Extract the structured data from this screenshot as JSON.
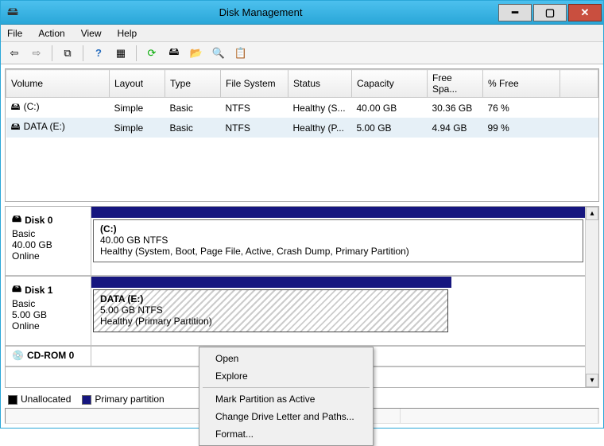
{
  "window": {
    "title": "Disk Management"
  },
  "menu": {
    "file": "File",
    "action": "Action",
    "view": "View",
    "help": "Help"
  },
  "columns": {
    "volume": "Volume",
    "layout": "Layout",
    "type": "Type",
    "fs": "File System",
    "status": "Status",
    "capacity": "Capacity",
    "free": "Free Spa...",
    "pct": "% Free"
  },
  "volumes": [
    {
      "name": "(C:)",
      "layout": "Simple",
      "type": "Basic",
      "fs": "NTFS",
      "status": "Healthy (S...",
      "capacity": "40.00 GB",
      "free": "30.36 GB",
      "pct": "76 %"
    },
    {
      "name": "DATA (E:)",
      "layout": "Simple",
      "type": "Basic",
      "fs": "NTFS",
      "status": "Healthy (P...",
      "capacity": "5.00 GB",
      "free": "4.94 GB",
      "pct": "99 %"
    }
  ],
  "disks": [
    {
      "label": "Disk 0",
      "kind": "Basic",
      "size": "40.00 GB",
      "state": "Online",
      "partition": {
        "name": "(C:)",
        "line2": "40.00 GB NTFS",
        "line3": "Healthy (System, Boot, Page File, Active, Crash Dump, Primary Partition)"
      }
    },
    {
      "label": "Disk 1",
      "kind": "Basic",
      "size": "5.00 GB",
      "state": "Online",
      "partition": {
        "name": "DATA  (E:)",
        "line2": "5.00 GB NTFS",
        "line3": "Healthy (Primary Partition)"
      }
    }
  ],
  "cdrom": {
    "label": "CD-ROM 0"
  },
  "legend": {
    "unallocated": "Unallocated",
    "primary": "Primary partition"
  },
  "context_menu": {
    "open": "Open",
    "explore": "Explore",
    "mark_active": "Mark Partition as Active",
    "change_letter": "Change Drive Letter and Paths...",
    "format": "Format..."
  }
}
